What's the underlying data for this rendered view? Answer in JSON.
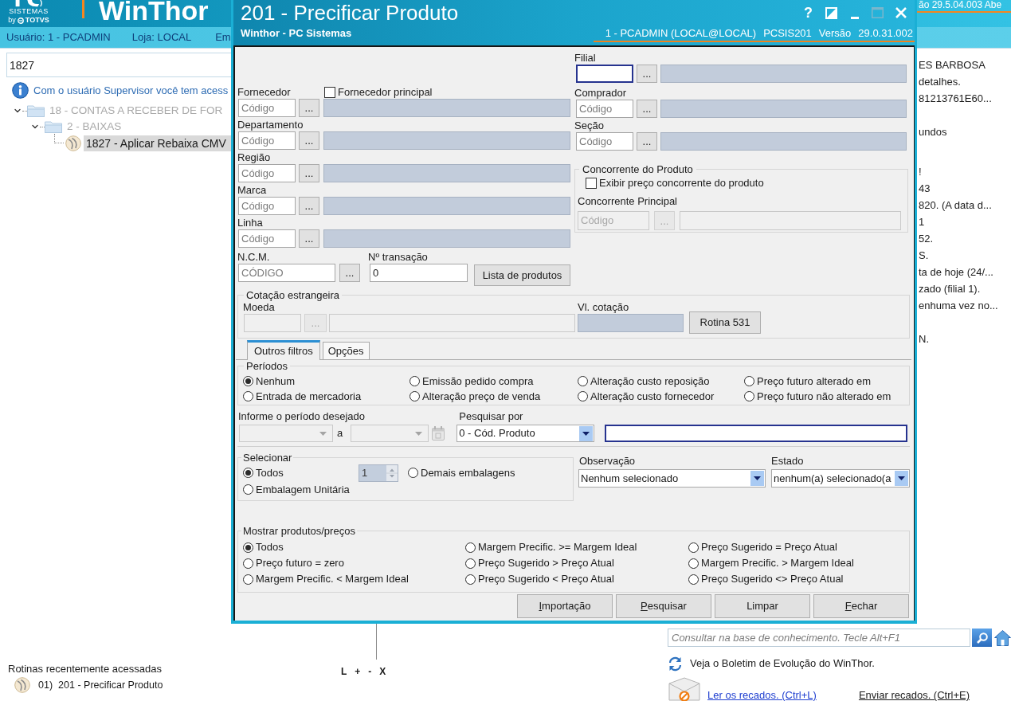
{
  "app": {
    "logo": {
      "tagline": "SISTEMAS",
      "by": "by",
      "brand": "TOTVS"
    },
    "title": "WinThor",
    "version_text": "ão 29.5.04.003 Abe",
    "user_strip": [
      "Usuário: 1 - PCADMIN",
      "Loja: LOCAL",
      "Em"
    ],
    "search": {
      "value": "1827"
    },
    "info_text": "Com o usuário Supervisor você tem acess",
    "tree": [
      {
        "label": "18 - CONTAS A RECEBER DE FOR",
        "kind": "folder",
        "expanded": true,
        "disabled": true,
        "selected": false,
        "children": [
          {
            "label": "2 - BAIXAS",
            "kind": "folder",
            "expanded": true,
            "disabled": true,
            "selected": false,
            "children": [
              {
                "label": "1827 - Aplicar Rebaixa CMV",
                "kind": "routine",
                "disabled": false,
                "selected": true
              }
            ]
          }
        ]
      }
    ],
    "messages": [
      [
        "ES BARBOSA",
        "detalhes.",
        "81213761E60..."
      ],
      [
        "undos"
      ],
      [
        "!",
        "43",
        "820. (A data d...",
        "1",
        "52.",
        "S.",
        "ta de hoje (24/...",
        "zado (filial 1).",
        "enhuma vez no..."
      ],
      [
        "N."
      ]
    ],
    "recent": {
      "title": "Rotinas recentemente acessadas",
      "items": [
        {
          "index": "01)",
          "label": "201 - Precificar Produto"
        }
      ]
    },
    "panel_controls": [
      "L",
      "+",
      "-",
      "X"
    ],
    "knowledge_search": {
      "placeholder": "Consultar na base de conhecimento. Tecle Alt+F1"
    },
    "bulletin": "Veja o Boletim de Evolução do WinThor.",
    "links": [
      {
        "label": "Ler os recados. (Ctrl+L)",
        "color": "#1f3fd0"
      },
      {
        "label": "Enviar recados. (Ctrl+E)",
        "color": "#1a1a1a"
      }
    ]
  },
  "dialog": {
    "title": "201 - Precificar Produto",
    "subtitle": "Winthor - PC Sistemas",
    "window_controls": [
      {
        "kind": "help",
        "label": "?",
        "disabled": false
      },
      {
        "kind": "theme",
        "disabled": false
      },
      {
        "kind": "minimize",
        "disabled": false
      },
      {
        "kind": "maximize",
        "disabled": true
      },
      {
        "kind": "close",
        "disabled": false
      }
    ],
    "session": [
      "1 - PCADMIN (LOCAL@LOCAL)",
      "PCSIS201",
      "Versão",
      "29.0.31.002"
    ],
    "lookups_left": [
      {
        "label": "Fornecedor",
        "placeholder": "Código",
        "button": "...",
        "focused": false,
        "checkbox": {
          "label": "Fornecedor principal",
          "checked": false
        }
      },
      {
        "label": "Departamento",
        "placeholder": "Código",
        "button": "...",
        "focused": false
      },
      {
        "label": "Região",
        "placeholder": "Código",
        "button": "...",
        "focused": false
      },
      {
        "label": "Marca",
        "placeholder": "Código",
        "button": "...",
        "focused": false
      },
      {
        "label": "Linha",
        "placeholder": "Código",
        "button": "...",
        "focused": false
      }
    ],
    "lookups_right": [
      {
        "label": "Filial",
        "button": "...",
        "focused": true
      },
      {
        "label": "Comprador",
        "placeholder": "Código",
        "button": "...",
        "focused": false
      },
      {
        "label": "Seção",
        "placeholder": "Código",
        "button": "...",
        "focused": false
      }
    ],
    "competitor": {
      "title": "Concorrente do Produto",
      "checkbox": {
        "label": "Exibir preço concorrente do produto",
        "checked": false
      },
      "lookup": {
        "label": "Concorrente Principal",
        "placeholder": "Código",
        "button": "...",
        "disabled": true
      }
    },
    "ncm": {
      "label": "N.C.M.",
      "placeholder": "CÓDIGO",
      "button": "..."
    },
    "transaction": {
      "label": "Nº transação",
      "value": "0"
    },
    "products_button": "Lista de produtos",
    "foreign_rate": {
      "title": "Cotação estrangeira",
      "currency": {
        "label": "Moeda",
        "button": "...",
        "disabled": true
      },
      "rate_label": "Vl. cotação",
      "button": "Rotina 531"
    },
    "tabs": [
      {
        "label": "Outros filtros",
        "selected": true
      },
      {
        "label": "Opções",
        "selected": false
      }
    ],
    "periods": {
      "title": "Períodos",
      "options": [
        {
          "label": "Nenhum",
          "selected": true
        },
        {
          "label": "Emissão pedido compra",
          "selected": false
        },
        {
          "label": "Alteração custo reposição",
          "selected": false
        },
        {
          "label": "Preço futuro alterado em",
          "selected": false
        },
        {
          "label": "Entrada de mercadoria",
          "selected": false
        },
        {
          "label": "Alteração preço de venda",
          "selected": false
        },
        {
          "label": "Alteração custo fornecedor",
          "selected": false
        },
        {
          "label": "Preço futuro não alterado em",
          "selected": false
        }
      ]
    },
    "period_range": {
      "label": "Informe o período desejado",
      "separator": "a",
      "disabled": true
    },
    "search_by": {
      "label": "Pesquisar por",
      "value": "0 - Cód. Produto"
    },
    "search_text": {
      "focused": true
    },
    "select": {
      "title": "Selecionar",
      "options": [
        {
          "label": "Todos",
          "selected": true
        },
        {
          "label": "Demais embalagens",
          "selected": false
        },
        {
          "label": "Embalagem Unitária",
          "selected": false
        }
      ],
      "quantity": {
        "value": "1",
        "disabled": true
      }
    },
    "observation": {
      "label": "Observação",
      "value": "Nenhum selecionado"
    },
    "state": {
      "label": "Estado",
      "value": "nenhum(a) selecionado(a"
    },
    "show": {
      "title": "Mostrar produtos/preços",
      "options": [
        {
          "label": "Todos",
          "selected": true
        },
        {
          "label": "Margem Precific. >= Margem Ideal",
          "selected": false
        },
        {
          "label": "Preço Sugerido = Preço Atual",
          "selected": false
        },
        {
          "label": "Preço futuro = zero",
          "selected": false
        },
        {
          "label": "Preço Sugerido > Preço Atual",
          "selected": false
        },
        {
          "label": "Margem Precific. > Margem Ideal",
          "selected": false
        },
        {
          "label": "Margem Precific. < Margem Ideal",
          "selected": false
        },
        {
          "label": "Preço Sugerido < Preço Atual",
          "selected": false
        },
        {
          "label": "Preço Sugerido <> Preço Atual",
          "selected": false
        }
      ]
    },
    "buttons": [
      {
        "label": "Importação",
        "access_key": true
      },
      {
        "label": "Pesquisar",
        "access_key": true
      },
      {
        "label": "Limpar",
        "access_key": false
      },
      {
        "label": "Fechar",
        "access_key": true
      }
    ]
  }
}
